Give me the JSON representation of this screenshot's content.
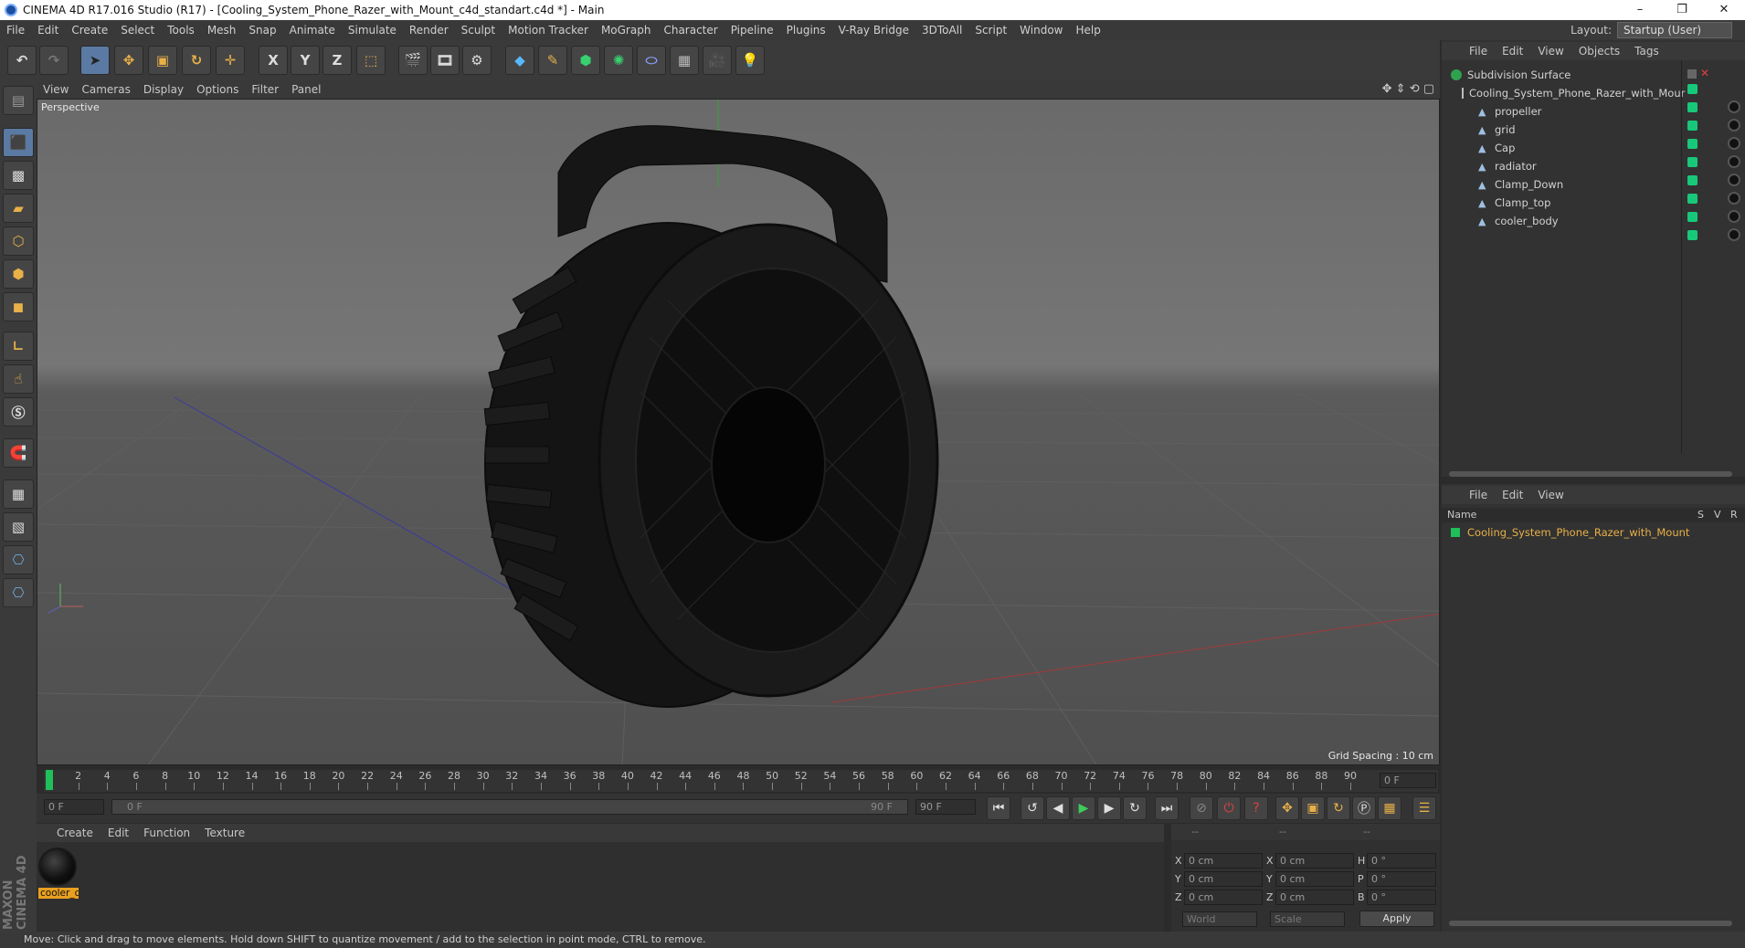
{
  "window": {
    "title": "CINEMA 4D R17.016 Studio (R17) - [Cooling_System_Phone_Razer_with_Mount_c4d_standart.c4d *] - Main",
    "controls": [
      "–",
      "❐",
      "✕"
    ]
  },
  "menubar": {
    "items": [
      "File",
      "Edit",
      "Create",
      "Select",
      "Tools",
      "Mesh",
      "Snap",
      "Animate",
      "Simulate",
      "Render",
      "Sculpt",
      "Motion Tracker",
      "MoGraph",
      "Character",
      "Pipeline",
      "Plugins",
      "V-Ray Bridge",
      "3DToAll",
      "Script",
      "Window",
      "Help"
    ],
    "layout_label": "Layout:",
    "layout_value": "Startup (User)"
  },
  "toolbar": {
    "axis_x": "X",
    "axis_y": "Y",
    "axis_z": "Z"
  },
  "viewport": {
    "menu": [
      "View",
      "Cameras",
      "Display",
      "Options",
      "Filter",
      "Panel"
    ],
    "label": "Perspective",
    "grid_spacing": "Grid Spacing : 10 cm"
  },
  "object_manager": {
    "menu": [
      "File",
      "Edit",
      "View",
      "Objects",
      "Tags"
    ],
    "objects": [
      {
        "name": "Subdivision Surface",
        "level": 0,
        "type": "subdivision"
      },
      {
        "name": "Cooling_System_Phone_Razer_with_Mour",
        "level": 1,
        "type": "null"
      },
      {
        "name": "propeller",
        "level": 2,
        "type": "polygon"
      },
      {
        "name": "grid",
        "level": 2,
        "type": "polygon"
      },
      {
        "name": "Cap",
        "level": 2,
        "type": "polygon"
      },
      {
        "name": "radiator",
        "level": 2,
        "type": "polygon"
      },
      {
        "name": "Clamp_Down",
        "level": 2,
        "type": "polygon"
      },
      {
        "name": "Clamp_top",
        "level": 2,
        "type": "polygon"
      },
      {
        "name": "cooler_body",
        "level": 2,
        "type": "polygon"
      }
    ]
  },
  "layer_manager": {
    "menu": [
      "File",
      "Edit",
      "View"
    ],
    "columns": {
      "name": "Name",
      "s": "S",
      "v": "V",
      "r": "R"
    },
    "layers": [
      {
        "name": "Cooling_System_Phone_Razer_with_Mount",
        "color": "#1fbf5a"
      }
    ]
  },
  "timeline": {
    "ticks": [
      "0",
      "2",
      "4",
      "6",
      "8",
      "10",
      "12",
      "14",
      "16",
      "18",
      "20",
      "22",
      "24",
      "26",
      "28",
      "30",
      "32",
      "34",
      "36",
      "38",
      "40",
      "42",
      "44",
      "46",
      "48",
      "50",
      "52",
      "54",
      "56",
      "58",
      "60",
      "62",
      "64",
      "66",
      "68",
      "70",
      "72",
      "74",
      "76",
      "78",
      "80",
      "82",
      "84",
      "86",
      "88",
      "90"
    ],
    "current_frame": "0 F",
    "start_field": "0 F",
    "range_start": "0 F",
    "range_end": "90 F",
    "end_field": "90 F"
  },
  "material_manager": {
    "menu": [
      "Create",
      "Edit",
      "Function",
      "Texture"
    ],
    "materials": [
      {
        "name": "cooler_d"
      }
    ]
  },
  "coordinates": {
    "headers": [
      "--",
      "--",
      "--"
    ],
    "rows": [
      {
        "a": "X",
        "av": "0 cm",
        "b": "X",
        "bv": "0 cm",
        "c": "H",
        "cv": "0 °"
      },
      {
        "a": "Y",
        "av": "0 cm",
        "b": "Y",
        "bv": "0 cm",
        "c": "P",
        "cv": "0 °"
      },
      {
        "a": "Z",
        "av": "0 cm",
        "b": "Z",
        "bv": "0 cm",
        "c": "B",
        "cv": "0 °"
      }
    ],
    "world": "World",
    "scale": "Scale",
    "apply": "Apply"
  },
  "brand": "MAXON CINEMA 4D",
  "status": "Move: Click and drag to move elements. Hold down SHIFT to quantize movement / add to the selection in point mode, CTRL to remove.",
  "colors": {
    "accent": "#e8b048",
    "selection": "#5b7aa3",
    "tag_green": "#18c87a",
    "layer_text": "#e8b048"
  }
}
